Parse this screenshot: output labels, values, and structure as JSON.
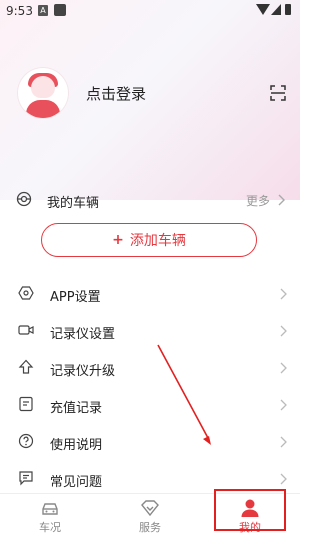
{
  "status_bar": {
    "time": "9:53",
    "notification_letter": "A"
  },
  "profile": {
    "login_label": "点击登录"
  },
  "vehicles": {
    "title": "我的车辆",
    "more_label": "更多",
    "add_button_label": "添加车辆",
    "add_button_plus": "+"
  },
  "menu": {
    "items": [
      {
        "label": "APP设置",
        "icon": "hexagon-settings-icon"
      },
      {
        "label": "记录仪设置",
        "icon": "camera-icon"
      },
      {
        "label": "记录仪升级",
        "icon": "upgrade-arrow-icon"
      },
      {
        "label": "充值记录",
        "icon": "receipt-icon"
      },
      {
        "label": "使用说明",
        "icon": "question-icon"
      },
      {
        "label": "常见问题",
        "icon": "chat-icon"
      }
    ]
  },
  "tabbar": {
    "tabs": [
      {
        "label": "车况",
        "icon": "car-icon"
      },
      {
        "label": "服务",
        "icon": "diamond-icon"
      },
      {
        "label": "我的",
        "icon": "person-icon"
      }
    ],
    "active_index": 2
  },
  "colors": {
    "accent": "#e53940",
    "highlight_box": "#e32020"
  }
}
